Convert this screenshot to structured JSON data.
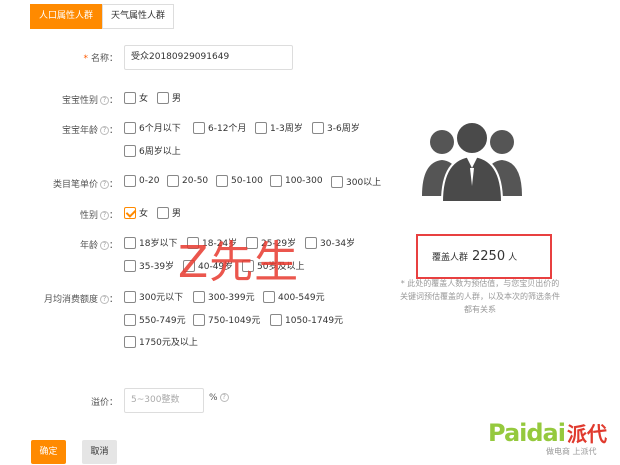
{
  "tabs": [
    {
      "label": "人口属性人群",
      "active": true
    },
    {
      "label": "天气属性人群",
      "active": false
    }
  ],
  "form": {
    "name": {
      "required_mark": "*",
      "label": "名称：",
      "value": "受众20180929091649"
    },
    "baby_gender": {
      "label": "宝宝性别",
      "options": [
        "女",
        "男"
      ]
    },
    "baby_age": {
      "label": "宝宝年龄",
      "options": [
        "6个月以下",
        "6-12个月",
        "1-3周岁",
        "3-6周岁",
        "6周岁以上"
      ]
    },
    "category_price": {
      "label": "类目笔单价",
      "options": [
        "0-20",
        "20-50",
        "50-100",
        "100-300",
        "300以上"
      ]
    },
    "gender": {
      "label": "性别",
      "options": [
        "女",
        "男"
      ],
      "checked": [
        "女"
      ]
    },
    "age": {
      "label": "年龄",
      "options": [
        "18岁以下",
        "18-24岁",
        "25-29岁",
        "30-34岁",
        "35-39岁",
        "40-49岁",
        "50岁及以上"
      ]
    },
    "monthly_spend": {
      "label": "月均消费额度",
      "options": [
        "300元以下",
        "300-399元",
        "400-549元",
        "550-749元",
        "750-1049元",
        "1050-1749元",
        "1750元及以上"
      ]
    },
    "premium": {
      "label": "溢价：",
      "placeholder": "5~300整数",
      "unit": "%"
    },
    "help_glyph": "?",
    "colon": "："
  },
  "actions": {
    "ok_label": "确定",
    "cancel_label": "取消"
  },
  "coverage": {
    "prefix": "覆盖人群",
    "value": "2250",
    "unit": "人"
  },
  "note": {
    "lines": [
      "* 此处的覆盖人数为预估值，与您宝贝出价的",
      "关键词预估覆盖的人群，以及本次的筛选条件",
      "都有关系"
    ]
  },
  "watermark": {
    "text": "Z先生"
  },
  "logo": {
    "main": "Paidai",
    "cn": "派代",
    "sub": "做电商 上派代"
  },
  "colors": {
    "accent": "#ff8a00",
    "highlight_border": "#e84040",
    "logo_green": "#95c93d",
    "logo_red": "#e03a2e"
  },
  "icons": {
    "people": "people-group-icon",
    "help": "help-circle-icon",
    "check": "checkmark-icon"
  }
}
